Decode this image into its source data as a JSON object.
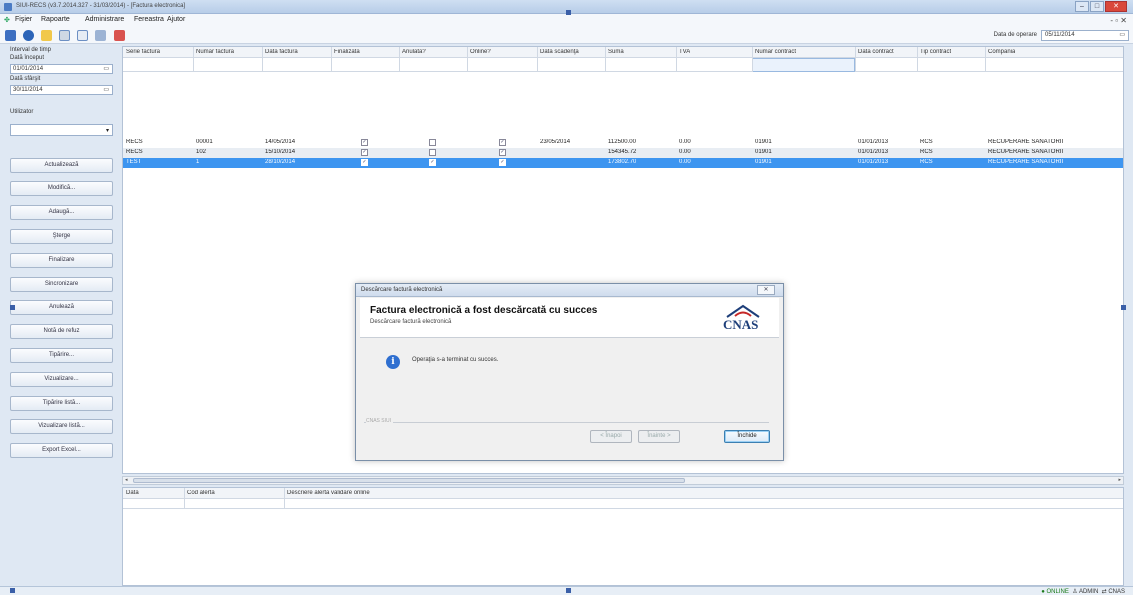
{
  "window": {
    "title": "SIUI-RECS (v3.7.2014.327 - 31/03/2014) - [Factura electronica]",
    "min": "‒",
    "max": "□",
    "close": "✕"
  },
  "menu": [
    "Fişier",
    "Rapoarte",
    "Administrare",
    "Fereastra",
    "Ajutor"
  ],
  "menu_right": "- ▫ ✕",
  "toolbar": {
    "operation_date_label": "Data de operare",
    "operation_date_value": "05/11/2014",
    "calendar_icon": "calendar-icon"
  },
  "left": {
    "interval_label": "Interval de timp",
    "start_label": "Dată început",
    "start_value": "01/01/2014",
    "end_label": "Dată sfârşit",
    "end_value": "30/11/2014",
    "user_label": "Utilizator",
    "user_value": "",
    "buttons": [
      "Actualizează",
      "Modifică...",
      "Adaugă...",
      "Şterge",
      "Finalizare",
      "Sincronizare",
      "Anulează",
      "Notă de refuz",
      "Tipărire...",
      "Vizualizare...",
      "Tipărire listă...",
      "Vizualizare listă...",
      "Export Excel..."
    ]
  },
  "grid": {
    "columns": [
      "Serie factură",
      "Număr factură",
      "Dată factură",
      "Finalizată",
      "Anulată?",
      "Online?",
      "Dată scadenţă",
      "Suma",
      "TVA",
      "Număr contract",
      "Dată contract",
      "Tip contract",
      "Compania"
    ],
    "rows": [
      {
        "serie": "RECS",
        "numar": "00001",
        "data": "14/05/2014",
        "finalizata": true,
        "anulata": false,
        "online": true,
        "scadenta": "23/05/2014",
        "suma": "112500.00",
        "tva": "0.00",
        "contract": "01901",
        "data_contract": "01/01/2013",
        "tip": "RCS",
        "compania": "RECUPERARE SANATORII"
      },
      {
        "serie": "RECS",
        "numar": "102",
        "data": "15/10/2014",
        "finalizata": true,
        "anulata": false,
        "online": true,
        "scadenta": "",
        "suma": "154345.72",
        "tva": "0.00",
        "contract": "01901",
        "data_contract": "01/01/2013",
        "tip": "RCS",
        "compania": "RECUPERARE SANATORII"
      },
      {
        "serie": "TEST",
        "numar": "1",
        "data": "28/10/2014",
        "finalizata": true,
        "anulata": true,
        "online": true,
        "scadenta": "",
        "suma": "173802.70",
        "tva": "0.00",
        "contract": "01901",
        "data_contract": "01/01/2013",
        "tip": "RCS",
        "compania": "RECUPERARE SANATORII"
      }
    ]
  },
  "alerts": {
    "columns": [
      "Data",
      "Cod alertă",
      "Descriere alertă validare online"
    ]
  },
  "status": {
    "online": "ONLINE",
    "user": "ADMIN",
    "server": "CNAS"
  },
  "dialog": {
    "title": "Descărcare factură electronică",
    "close": "✕",
    "heading": "Factura electronică a fost descărcată cu succes",
    "subheading": "Descărcare factură electronică",
    "logo_text": "CNAS",
    "message": "Operaţia s-a terminat cu succes.",
    "group_label": "CNAS SIUI",
    "back_label": "< Înapoi",
    "next_label": "Înainte >",
    "close_label": "Închide"
  },
  "colors": {
    "selection": "#3d95f0",
    "info": "#2f6fd0",
    "logo": "#1e3f7a"
  }
}
